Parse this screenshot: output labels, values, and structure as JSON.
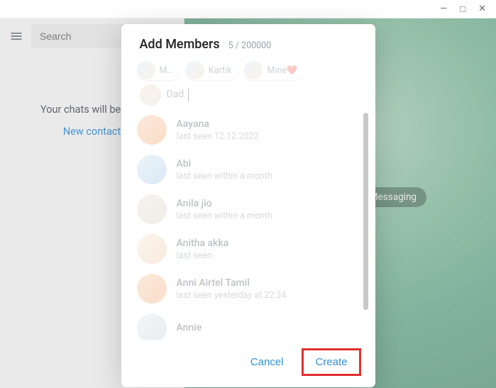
{
  "window": {
    "minimize": "—",
    "maximize": "□",
    "close": "✕"
  },
  "sidebar": {
    "search_placeholder": "Search",
    "empty_text": "Your chats will be here",
    "new_contact": "New contact"
  },
  "background_badge": "Start Messaging",
  "modal": {
    "title": "Add Members",
    "count": "5 / 200000",
    "chips": [
      {
        "label": "M…"
      },
      {
        "label": "Kartik"
      },
      {
        "label": "Mine❤️"
      }
    ],
    "input_name": "Dad",
    "contacts": [
      {
        "name": "Aayana",
        "status": "last seen 12.12.2022",
        "bg": "linear-gradient(135deg,#f7c6a5,#f2a66e)"
      },
      {
        "name": "Abi",
        "status": "last seen within a month",
        "bg": "linear-gradient(135deg,#c7e0f2,#9fc5e6)"
      },
      {
        "name": "Anila jio",
        "status": "last seen within a month",
        "bg": "linear-gradient(135deg,#e9e1d6,#d8cebe)"
      },
      {
        "name": "Anitha akka",
        "status": "last seen",
        "bg": "linear-gradient(135deg,#f7e5d2,#e9c9a4)"
      },
      {
        "name": "Anni Airtel Tamil",
        "status": "last seen yesterday at 22:34",
        "bg": "linear-gradient(135deg,#f5c6a1,#f1a774)"
      },
      {
        "name": "Annie",
        "status": "",
        "bg": "linear-gradient(135deg,#dfe6ec,#c6cfd8)"
      }
    ],
    "cancel": "Cancel",
    "create": "Create"
  }
}
